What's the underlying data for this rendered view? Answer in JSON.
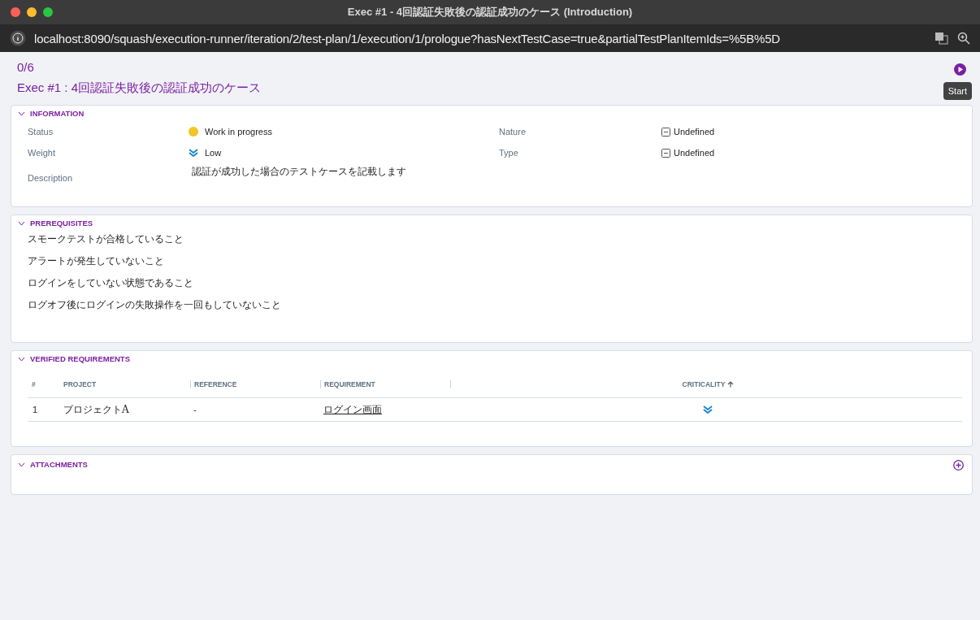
{
  "window": {
    "title": "Exec #1 - 4回認証失敗後の認証成功のケース (Introduction)"
  },
  "address_bar": {
    "url": "localhost:8090/squash/execution-runner/iteration/2/test-plan/1/execution/1/prologue?hasNextTestCase=true&partialTestPlanItemIds=%5B%5D"
  },
  "progress": "0/6",
  "heading": "Exec #1 : 4回認証失敗後の認証成功のケース",
  "start_tooltip": "Start",
  "information": {
    "title": "INFORMATION",
    "expanded": true,
    "fields": [
      {
        "label": "Status",
        "value": "Work in progress",
        "kind": "status",
        "color": "#f2c425"
      },
      {
        "label": "Nature",
        "value": "Undefined",
        "kind": "list"
      },
      {
        "label": "Weight",
        "value": "Low",
        "kind": "weight"
      },
      {
        "label": "Type",
        "value": "Undefined",
        "kind": "list"
      },
      {
        "label": "Description",
        "value": "認証が成功した場合のテストケースを記載します",
        "kind": "text"
      }
    ]
  },
  "prerequisites": {
    "title": "PREREQUISITES",
    "expanded": true,
    "lines": [
      "スモークテストが合格していること",
      "アラートが発生していないこと",
      "ログインをしていない状態であること",
      "ログオフ後にログインの失敗操作を一回もしていないこと"
    ]
  },
  "verified_requirements": {
    "title": "VERIFIED REQUIREMENTS",
    "expanded": true,
    "columns": [
      "#",
      "PROJECT",
      "REFERENCE",
      "REQUIREMENT",
      "CRITICALITY"
    ],
    "rows": [
      {
        "index": "1",
        "project": "プロジェクトA",
        "reference": "-",
        "requirement": "ログイン画面"
      }
    ]
  },
  "attachments": {
    "title": "ATTACHMENTS",
    "expanded": true
  }
}
